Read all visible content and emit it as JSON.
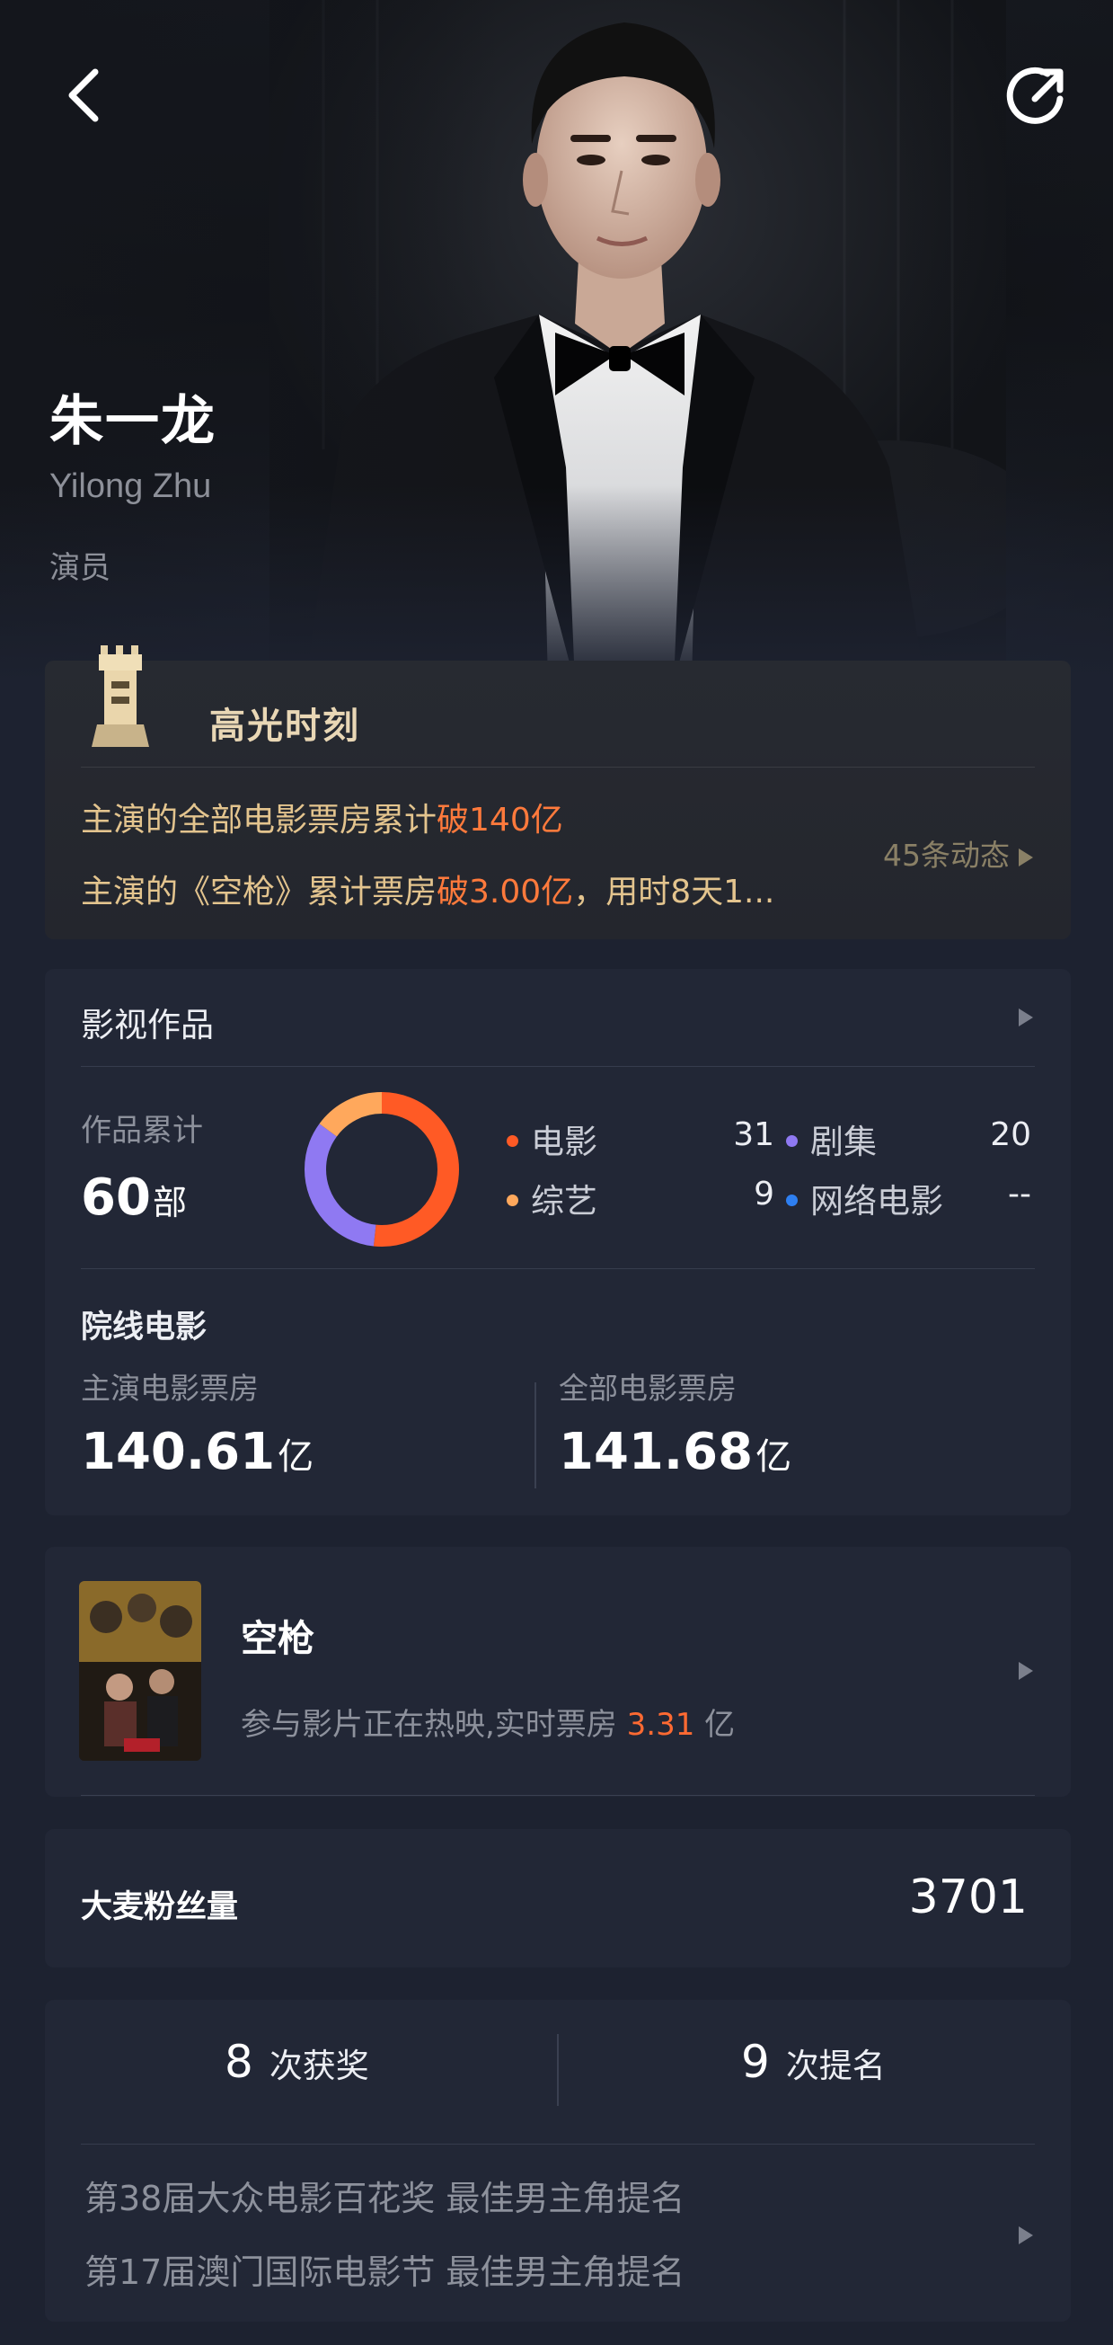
{
  "colors": {
    "background": "#1d2230",
    "card": "#222736",
    "accent_orange": "#ff6a32",
    "gold": "#e3c48e",
    "purple": "#8f79f2",
    "blue": "#2e7ff1"
  },
  "header": {
    "back_icon": "chevron-left-icon",
    "share_icon": "share-icon"
  },
  "profile": {
    "name_cn": "朱一龙",
    "name_en": "Yilong Zhu",
    "role": "演员"
  },
  "highlight": {
    "title": "高光时刻",
    "line1_prefix": "主演的全部电影票房累计",
    "line1_strong": "破140亿",
    "line2_prefix": "主演的《空枪》累计票房",
    "line2_strong": "破3.00亿",
    "line2_suffix": "，用时8天1...",
    "more": "45条动态"
  },
  "works": {
    "title": "影视作品",
    "total_label": "作品累计",
    "total_value": "60",
    "total_unit": "部",
    "categories": [
      {
        "label": "电影",
        "value": "31",
        "color": "#ff5a25"
      },
      {
        "label": "剧集",
        "value": "20",
        "color": "#8f79f2"
      },
      {
        "label": "综艺",
        "value": "9",
        "color": "#ffa85c"
      },
      {
        "label": "网络电影",
        "value": "--",
        "color": "#2e7ff1"
      }
    ],
    "cinema_title": "院线电影",
    "lead_label": "主演电影票房",
    "lead_value": "140.61",
    "lead_unit": "亿",
    "all_label": "全部电影票房",
    "all_value": "141.68",
    "all_unit": "亿"
  },
  "movie": {
    "title": "空枪",
    "sub_prefix": "参与影片正在热映,实时票房 ",
    "sub_value": "3.31",
    "sub_suffix": " 亿"
  },
  "fans": {
    "label": "大麦粉丝量",
    "value": "3701"
  },
  "awards": {
    "wins_value": "8",
    "wins_label": "次获奖",
    "noms_value": "9",
    "noms_label": "次提名",
    "items": [
      "第38届大众电影百花奖 最佳男主角提名",
      "第17届澳门国际电影节 最佳男主角提名"
    ]
  }
}
